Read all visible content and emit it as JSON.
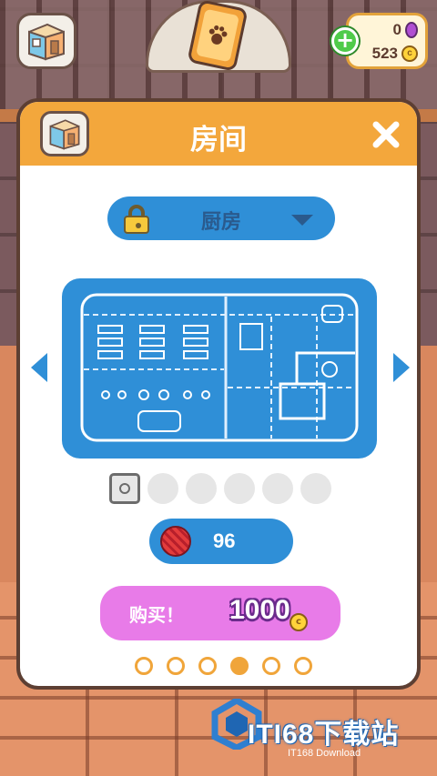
{
  "hud": {
    "gems": "0",
    "coins": "523",
    "add_symbol": "+",
    "coin_symbol": "c"
  },
  "dialog": {
    "title": "房间",
    "room_selector": {
      "selected": "厨房"
    },
    "cost": {
      "yarn": "96"
    },
    "buy": {
      "label": "购买！",
      "price": "1000",
      "coin_symbol": "c"
    },
    "pagination": {
      "total": 6,
      "active_index": 3
    }
  },
  "watermark": {
    "title": "ITI68下载站",
    "subtitle": "IT168 Download"
  },
  "colors": {
    "header_orange": "#f3a73c",
    "primary_blue": "#2f8fd7",
    "buy_pink": "#e87be8",
    "border_brown": "#5d3f33"
  },
  "icons": [
    "room-icon",
    "cat-paw-card-icon",
    "gem-icon",
    "coin-icon",
    "plus-icon",
    "close-icon",
    "lock-icon",
    "chevron-down-icon",
    "arrow-left-icon",
    "arrow-right-icon",
    "safe-icon",
    "yarn-ball-icon"
  ]
}
